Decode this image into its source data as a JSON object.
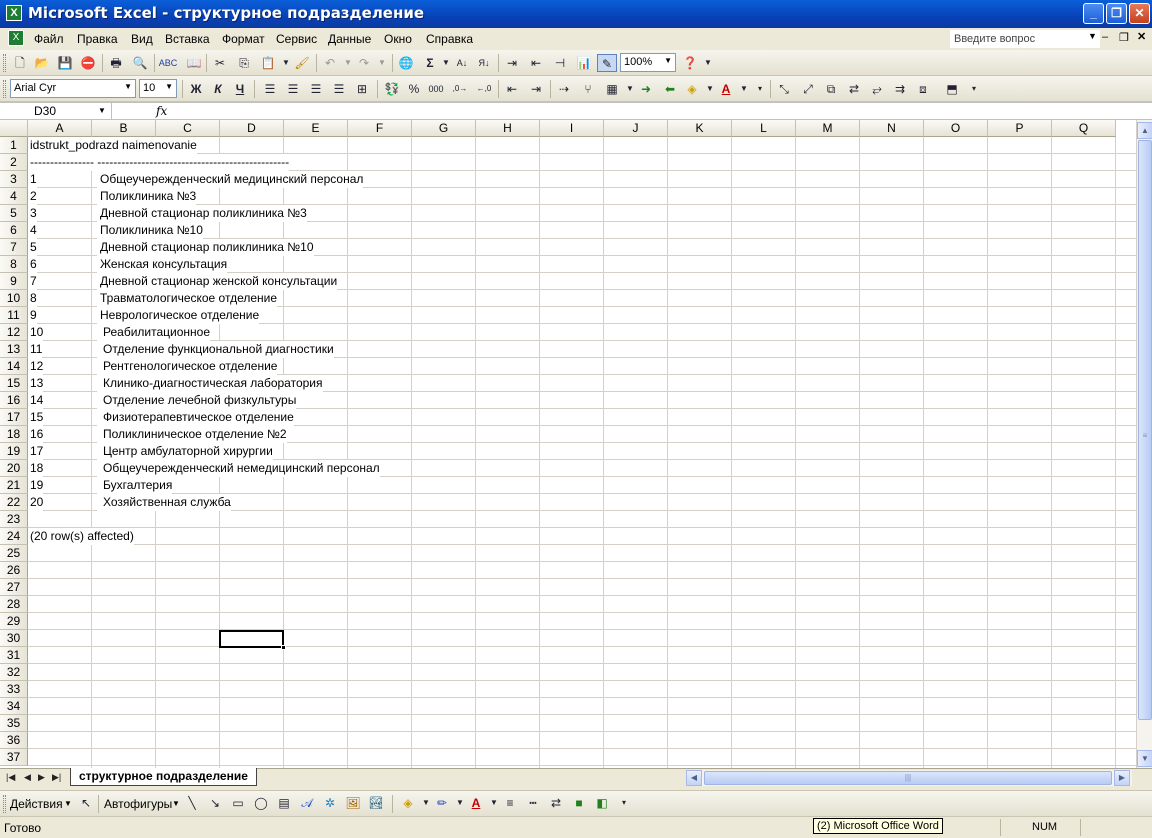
{
  "window": {
    "title": "Microsoft Excel - структурное подразделение",
    "min_label": "_",
    "max_label": "❐",
    "close_label": "✕"
  },
  "menu": {
    "items": [
      "Файл",
      "Правка",
      "Вид",
      "Вставка",
      "Формат",
      "Сервис",
      "Данные",
      "Окно",
      "Справка"
    ],
    "help_placeholder": "Введите вопрос"
  },
  "toolbar": {
    "zoom": "100%",
    "font_name": "Arial Cyr",
    "font_size": "10",
    "bold": "Ж",
    "italic": "К",
    "underline": "Ч",
    "sum": "Σ",
    "percent": "%",
    "thousands": "000"
  },
  "formula_bar": {
    "name_box": "D30",
    "fx": "fx",
    "content": ""
  },
  "columns": [
    "A",
    "B",
    "C",
    "D",
    "E",
    "F",
    "G",
    "H",
    "I",
    "J",
    "K",
    "L",
    "M",
    "N",
    "O",
    "P",
    "Q"
  ],
  "rows": [
    "1",
    "2",
    "3",
    "4",
    "5",
    "6",
    "7",
    "8",
    "9",
    "10",
    "11",
    "12",
    "13",
    "14",
    "15",
    "16",
    "17",
    "18",
    "19",
    "20",
    "21",
    "22",
    "23",
    "24",
    "25",
    "26",
    "27",
    "28",
    "29",
    "30",
    "31",
    "32",
    "33",
    "34",
    "35",
    "36",
    "37"
  ],
  "sheet": {
    "header": "idstrukt_podrazd naimenovanie",
    "separator": "---------------- ------------------------------------------------",
    "records": [
      {
        "id": "1",
        "name": "Общеучережденческий медицинский персонал"
      },
      {
        "id": "2",
        "name": "Поликлиника №3"
      },
      {
        "id": "3",
        "name": "Дневной стационар поликлиника №3"
      },
      {
        "id": "4",
        "name": "Поликлиника №10"
      },
      {
        "id": "5",
        "name": "Дневной стационар поликлиника №10"
      },
      {
        "id": "6",
        "name": "Женская консультация"
      },
      {
        "id": "7",
        "name": "Дневной стационар женской консультации"
      },
      {
        "id": "8",
        "name": "Травматологическое отделение"
      },
      {
        "id": "9",
        "name": "Неврологическое отделение"
      },
      {
        "id": "10",
        "name": "Реабилитационное"
      },
      {
        "id": "11",
        "name": "Отделение функциональной диагностики"
      },
      {
        "id": "12",
        "name": "Рентгенологическое отделение"
      },
      {
        "id": "13",
        "name": "Клинико-диагностическая лаборатория"
      },
      {
        "id": "14",
        "name": "Отделение лечебной физкультуры"
      },
      {
        "id": "15",
        "name": "Физиотерапевтическое отделение"
      },
      {
        "id": "16",
        "name": "Поликлиническое отделение №2"
      },
      {
        "id": "17",
        "name": "Центр амбулаторной хирургии"
      },
      {
        "id": "18",
        "name": "Общеучережденческий немедицинский персонал"
      },
      {
        "id": "19",
        "name": "Бухгалтерия"
      },
      {
        "id": "20",
        "name": "Хозяйственная служба"
      }
    ],
    "footer": "(20 row(s) affected)",
    "active_cell": "D30",
    "tab_name": "структурное подразделение"
  },
  "drawing_toolbar": {
    "actions_label": "Действия",
    "autoshapes_label": "Автофигуры"
  },
  "status": {
    "text": "Готово",
    "taskbar_tooltip": "(2) Microsoft Office Word",
    "num_indicator": "NUM"
  },
  "colors": {
    "title_blue": "#0842b8",
    "grid_line": "#d4d0c8",
    "toolbar_bg": "#ece9d8"
  }
}
